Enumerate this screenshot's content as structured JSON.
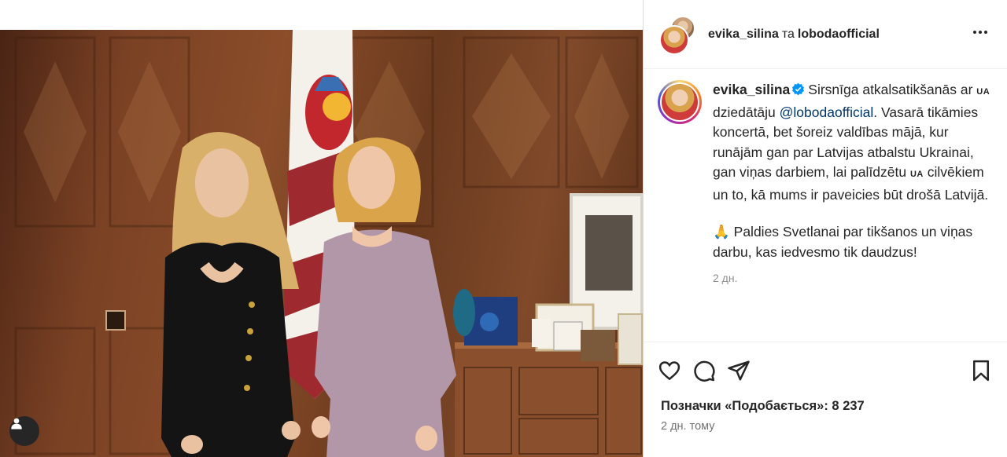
{
  "post": {
    "image_alt": "",
    "header": {
      "author": "evika_silina",
      "joiner": "та",
      "coauthor": "lobodaofficial"
    },
    "caption": {
      "username": "evika_silina",
      "text_part1": "Sirsnīga atkalsatikšanās ar ",
      "flag1": "UA",
      "text_part2": " dziedātāju ",
      "mention": "@lobodaofficial",
      "text_part3": ". Vasarā tikāmies koncertā, bet šoreiz valdības mājā, kur runājām gan par Latvijas atbalstu Ukrainai, gan viņas darbiem, lai palīdzētu ",
      "flag2": "UA",
      "text_part4": " cilvēkiem un to, kā mums ir paveicies būt drošā Latvijā.",
      "paragraph2": "🙏 Paldies Svetlanai par tikšanos un viņas darbu, kas iedvesmo tik daudzus!",
      "time": "2 дн."
    },
    "likes_text": "Позначки «Подобається»: 8 237",
    "posted_time": "2 дн. тому"
  },
  "icons": {
    "more": "more-options-icon",
    "like": "heart-icon",
    "comment": "comment-icon",
    "share": "paper-plane-icon",
    "save": "bookmark-icon",
    "tags": "user-tag-icon",
    "verified": "verified-badge-icon"
  },
  "colors": {
    "text": "#262626",
    "muted": "#8e8e8e",
    "mention": "#00376b",
    "verified": "#0095f6",
    "tag_button": "#262626"
  }
}
